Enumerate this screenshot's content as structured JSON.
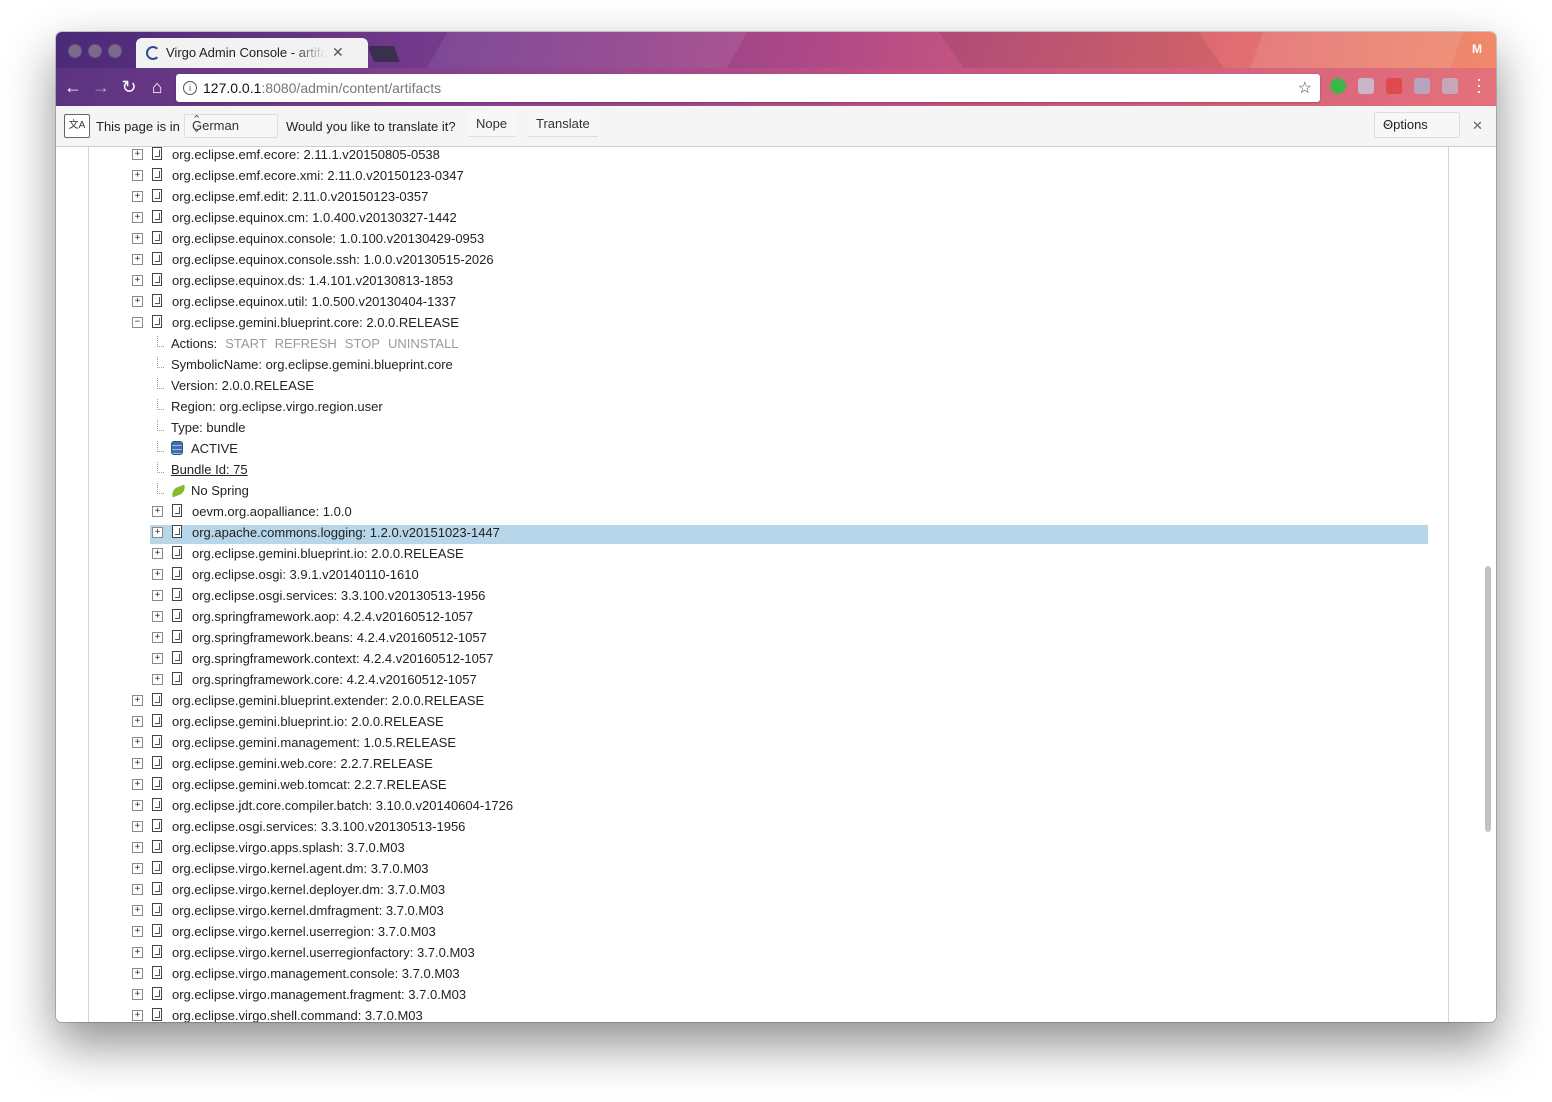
{
  "browser": {
    "tab_title": "Virgo Admin Console - artifacts",
    "profile_initial": "M",
    "url_host": "127.0.0.1",
    "url_path": ":8080/admin/content/artifacts"
  },
  "translate_bar": {
    "page_is_in": "This page is in",
    "language": "German",
    "question": "Would you like to translate it?",
    "nope": "Nope",
    "translate": "Translate",
    "options": "Options"
  },
  "tree": {
    "rows": [
      {
        "label": "org.eclipse.emf.ecore: 2.11.1.v20150805-0538"
      },
      {
        "label": "org.eclipse.emf.ecore.xmi: 2.11.0.v20150123-0347"
      },
      {
        "label": "org.eclipse.emf.edit: 2.11.0.v20150123-0357"
      },
      {
        "label": "org.eclipse.equinox.cm: 1.0.400.v20130327-1442"
      },
      {
        "label": "org.eclipse.equinox.console: 1.0.100.v20130429-0953"
      },
      {
        "label": "org.eclipse.equinox.console.ssh: 1.0.0.v20130515-2026"
      },
      {
        "label": "org.eclipse.equinox.ds: 1.4.101.v20130813-1853"
      },
      {
        "label": "org.eclipse.equinox.util: 1.0.500.v20130404-1337"
      },
      {
        "label": "org.eclipse.gemini.blueprint.core: 2.0.0.RELEASE"
      }
    ],
    "details": {
      "actions_label": "Actions:",
      "actions": [
        "START",
        "REFRESH",
        "STOP",
        "UNINSTALL"
      ],
      "symbolic_name": "SymbolicName: org.eclipse.gemini.blueprint.core",
      "version": "Version: 2.0.0.RELEASE",
      "region": "Region: org.eclipse.virgo.region.user",
      "type": "Type: bundle",
      "state": "ACTIVE",
      "bundle_id": "Bundle Id: 75",
      "spring": "No Spring"
    },
    "children": [
      {
        "label": "oevm.org.aopalliance: 1.0.0"
      },
      {
        "label": "org.apache.commons.logging: 1.2.0.v20151023-1447"
      },
      {
        "label": "org.eclipse.gemini.blueprint.io: 2.0.0.RELEASE"
      },
      {
        "label": "org.eclipse.osgi: 3.9.1.v20140110-1610"
      },
      {
        "label": "org.eclipse.osgi.services: 3.3.100.v20130513-1956"
      },
      {
        "label": "org.springframework.aop: 4.2.4.v20160512-1057"
      },
      {
        "label": "org.springframework.beans: 4.2.4.v20160512-1057"
      },
      {
        "label": "org.springframework.context: 4.2.4.v20160512-1057"
      },
      {
        "label": "org.springframework.core: 4.2.4.v20160512-1057"
      }
    ],
    "rows_after": [
      {
        "label": "org.eclipse.gemini.blueprint.extender: 2.0.0.RELEASE"
      },
      {
        "label": "org.eclipse.gemini.blueprint.io: 2.0.0.RELEASE"
      },
      {
        "label": "org.eclipse.gemini.management: 1.0.5.RELEASE"
      },
      {
        "label": "org.eclipse.gemini.web.core: 2.2.7.RELEASE"
      },
      {
        "label": "org.eclipse.gemini.web.tomcat: 2.2.7.RELEASE"
      },
      {
        "label": "org.eclipse.jdt.core.compiler.batch: 3.10.0.v20140604-1726"
      },
      {
        "label": "org.eclipse.osgi.services: 3.3.100.v20130513-1956"
      },
      {
        "label": "org.eclipse.virgo.apps.splash: 3.7.0.M03"
      },
      {
        "label": "org.eclipse.virgo.kernel.agent.dm: 3.7.0.M03"
      },
      {
        "label": "org.eclipse.virgo.kernel.deployer.dm: 3.7.0.M03"
      },
      {
        "label": "org.eclipse.virgo.kernel.dmfragment: 3.7.0.M03"
      },
      {
        "label": "org.eclipse.virgo.kernel.userregion: 3.7.0.M03"
      },
      {
        "label": "org.eclipse.virgo.kernel.userregionfactory: 3.7.0.M03"
      },
      {
        "label": "org.eclipse.virgo.management.console: 3.7.0.M03"
      },
      {
        "label": "org.eclipse.virgo.management.fragment: 3.7.0.M03"
      },
      {
        "label": "org.eclipse.virgo.shell.command: 3.7.0.M03"
      }
    ]
  }
}
